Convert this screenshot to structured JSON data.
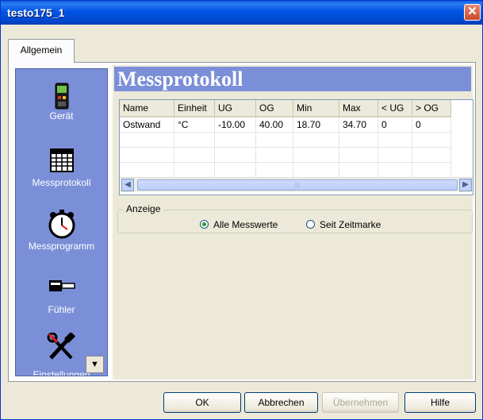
{
  "window": {
    "title": "testo175_1"
  },
  "tabs": [
    {
      "label": "Allgemein"
    }
  ],
  "sidebar": {
    "items": [
      {
        "label": "Gerät",
        "icon": "device-icon"
      },
      {
        "label": "Messprotokoll",
        "icon": "table-grid-icon"
      },
      {
        "label": "Messprogramm",
        "icon": "stopwatch-icon"
      },
      {
        "label": "Fühler",
        "icon": "probe-icon"
      },
      {
        "label": "Einstellungen",
        "icon": "tools-icon"
      }
    ]
  },
  "main": {
    "title": "Messprotokoll",
    "table": {
      "columns": [
        "Name",
        "Einheit",
        "UG",
        "OG",
        "Min",
        "Max",
        "< UG",
        "> OG"
      ],
      "rows": [
        [
          "Ostwand",
          "°C",
          "-10.00",
          "40.00",
          "18.70",
          "34.70",
          "0",
          "0"
        ]
      ]
    },
    "display_group": {
      "legend": "Anzeige",
      "options": [
        {
          "label": "Alle Messwerte",
          "selected": true
        },
        {
          "label": "Seit Zeitmarke",
          "selected": false
        }
      ]
    }
  },
  "buttons": {
    "ok": "OK",
    "cancel": "Abbrechen",
    "apply": "Übernehmen",
    "help": "Hilfe"
  },
  "colors": {
    "titlebar": "#0054e3",
    "sidebar": "#7b8fd8",
    "dialog_bg": "#ece9d8"
  }
}
